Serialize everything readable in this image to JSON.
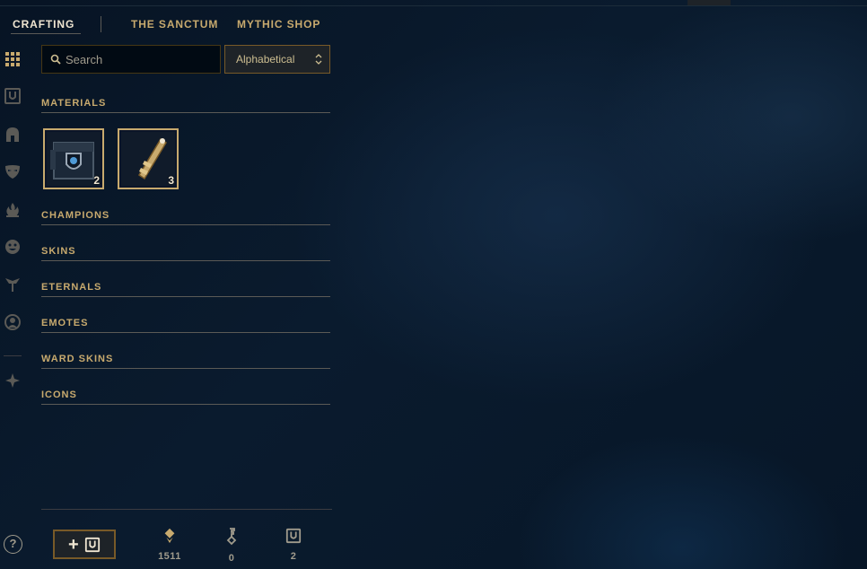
{
  "tabs": [
    {
      "label": "CRAFTING",
      "active": true
    },
    {
      "label": "THE SANCTUM",
      "active": false
    },
    {
      "label": "MYTHIC SHOP",
      "active": false
    }
  ],
  "sidebar": {
    "icons": [
      "grid-icon",
      "chest-icon",
      "helmet-icon",
      "mask-icon",
      "flame-icon",
      "emote-face-icon",
      "ward-totem-icon",
      "profile-icon-icon",
      "bundle-icon"
    ]
  },
  "search": {
    "placeholder": "Search",
    "value": ""
  },
  "sort": {
    "selected": "Alphabetical"
  },
  "sections": {
    "materials": "MATERIALS",
    "champions": "CHAMPIONS",
    "skins": "SKINS",
    "eternals": "ETERNALS",
    "emotes": "EMOTES",
    "ward_skins": "WARD SKINS",
    "icons": "ICONS"
  },
  "materials": [
    {
      "icon": "hextech-chest-icon",
      "count": "2"
    },
    {
      "icon": "hextech-key-icon",
      "count": "3"
    }
  ],
  "footer": {
    "add_label": "+",
    "currencies": [
      {
        "icon": "orange-essence-icon",
        "amount": "1511"
      },
      {
        "icon": "key-fragment-icon",
        "amount": "0"
      },
      {
        "icon": "chest-icon",
        "amount": "2"
      }
    ],
    "help_label": "?"
  },
  "colors": {
    "gold": "#c8aa6e",
    "gold_dark": "#785a28",
    "text": "#a09b8c",
    "bg": "#0a1b2e"
  }
}
